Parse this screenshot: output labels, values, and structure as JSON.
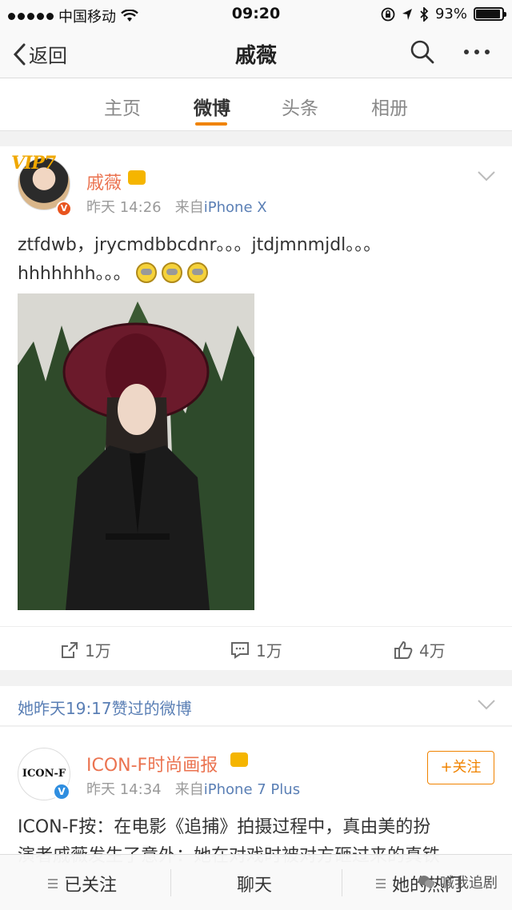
{
  "status_bar": {
    "carrier": "中国移动",
    "time": "09:20",
    "battery": "93%",
    "battery_level": 0.93
  },
  "nav": {
    "back_label": "返回",
    "title": "戚薇"
  },
  "tabs": [
    {
      "label": "主页"
    },
    {
      "label": "微博",
      "active": true
    },
    {
      "label": "头条"
    },
    {
      "label": "相册"
    }
  ],
  "post": {
    "vip_badge": "VIP7",
    "username": "戚薇",
    "time": "昨天 14:26",
    "source_prefix": "来自",
    "source": "iPhone X",
    "text_line1": "ztfdwb，jrycmdbbcdnr。。。jtdjmnmjdl。。。",
    "text_line2": "hhhhhhh。。。",
    "reposts": "1万",
    "comments": "1万",
    "likes": "4万"
  },
  "liked_header": "她昨天19:17赞过的微博",
  "post2": {
    "avatar_text": "ICON-F",
    "username": "ICON-F时尚画报",
    "time": "昨天 14:34",
    "source_prefix": "来自",
    "source": "iPhone 7 Plus",
    "follow_label": "+关注",
    "text_line1": "ICON-F按：在电影《追捕》拍摄过程中，真由美的扮",
    "text_line2": "演者戚薇发生了意外：她在对戏时被对方砸过来的真铁"
  },
  "bottom_bar": {
    "follow_status": "已关注",
    "chat": "聊天",
    "hot": "她的热门"
  },
  "watermark": "喊我追剧",
  "colors": {
    "accent": "#f08300",
    "username": "#eb7350",
    "link": "#5a7fb5"
  }
}
